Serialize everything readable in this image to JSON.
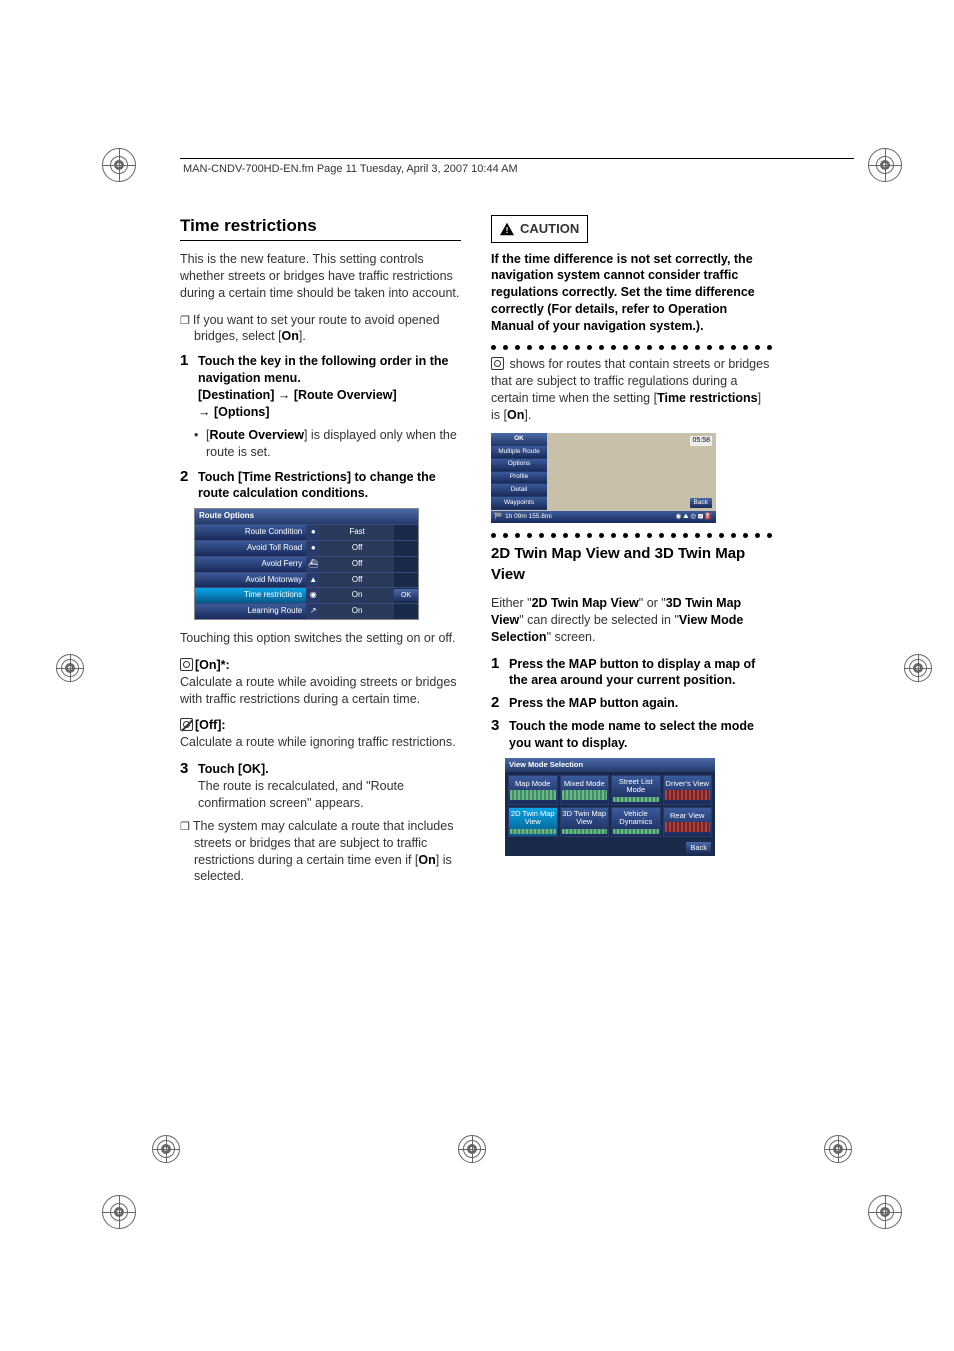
{
  "header": "MAN-CNDV-700HD-EN.fm  Page 11  Tuesday, April 3, 2007  10:44 AM",
  "section1_title": "Time restrictions",
  "intro1": "This is the new feature. This setting controls whether streets or bridges have traffic restrictions during a certain time should be taken into account.",
  "note1": "If you want to set your route to avoid opened bridges, select [",
  "note1_on": "On",
  "note1_end": "].",
  "step1a": "Touch the key in the following order in the navigation menu.",
  "step1b_a": "[Destination]",
  "step1b_b": "[Route Overview]",
  "step1b_c": "[Options]",
  "arrow": "→",
  "step1_sub_a": "[",
  "step1_sub_b": "Route Overview",
  "step1_sub_c": "] is displayed only when the route is set.",
  "step2": "Touch [Time Restrictions] to change the route calculation conditions.",
  "routeOptions": {
    "title": "Route Options",
    "rows": [
      {
        "label": "Route Condition",
        "icon": "●",
        "value": "Fast"
      },
      {
        "label": "Avoid Toll Road",
        "icon": "●",
        "value": "Off"
      },
      {
        "label": "Avoid Ferry",
        "icon": "⛴",
        "value": "Off"
      },
      {
        "label": "Avoid Motorway",
        "icon": "▲",
        "value": "Off"
      },
      {
        "label": "Time restrictions",
        "icon": "◉",
        "value": "On",
        "ok": "OK"
      },
      {
        "label": "Learning Route",
        "icon": "↗",
        "value": "On"
      }
    ]
  },
  "switch_para": "Touching this option switches the setting on or off.",
  "on_label": "[On]*:",
  "on_desc": "Calculate a route while avoiding streets or bridges with traffic restrictions during a certain time.",
  "off_label": "[Off]:",
  "off_desc": "Calculate a route while ignoring traffic restrictions.",
  "step3": "Touch [OK].",
  "step3_desc": "The route is recalculated, and \"Route confirmation screen\" appears.",
  "note2a": "The system may calculate a route that includes streets or bridges that are subject to traffic restrictions during a certain time even if [",
  "note2b": "On",
  "note2c": "] is selected.",
  "caution_label": "CAUTION",
  "caution_text": "If the time difference is not set correctly, the navigation system cannot consider traffic regulations correctly. Set the time difference correctly (For details, refer to Operation Manual of your navigation system.).",
  "right_para_a": " shows for routes that contain streets or bridges that are subject to traffic regulations during a certain time when the setting [",
  "right_para_b": "Time restrictions",
  "right_para_c": "] is [",
  "right_para_d": "On",
  "right_para_e": "].",
  "map": {
    "side": [
      "OK",
      "Multiple Route",
      "Options",
      "Profile",
      "Detail",
      "Waypoints"
    ],
    "clock": "05:58",
    "back": "Back",
    "bar": "1h 09m   155.8mi"
  },
  "section2_title": "2D Twin Map View and 3D Twin Map View",
  "sec2_para_a": "Either \"",
  "sec2_para_b": "2D Twin Map View",
  "sec2_para_c": "\" or \"",
  "sec2_para_d": "3D Twin Map View",
  "sec2_para_e": "\" can directly be selected in \"",
  "sec2_para_f": "View Mode Selection",
  "sec2_para_g": "\" screen.",
  "s2_step1": "Press the MAP button to display a map of the area around your current position.",
  "s2_step2": "Press the MAP button again.",
  "s2_step3": "Touch the mode name to select the mode you want to display.",
  "viewMode": {
    "title": "View Mode Selection",
    "cells": [
      "Map Mode",
      "Mixed Mode",
      "Street List Mode",
      "Driver's View",
      "2D Twin Map View",
      "3D Twin Map View",
      "Vehicle Dynamics",
      "Rear View"
    ],
    "back": "Back"
  }
}
